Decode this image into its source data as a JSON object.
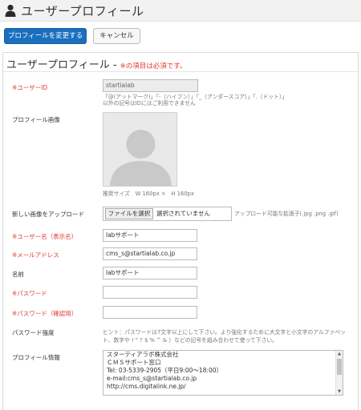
{
  "header": {
    "title": "ユーザープロフィール",
    "icon": "user-icon"
  },
  "actions": {
    "save_label": "プロフィールを変更する",
    "cancel_label": "キャンセル"
  },
  "panel": {
    "title": "ユーザープロフィール -",
    "required_note": "※の項目は必須です。"
  },
  "form": {
    "user_id": {
      "label": "※ユーザーID",
      "value": "startialab",
      "hint_line1": "「@(アットマーク)」「-（ハイフン）」「_（アンダースコア）」「.（ドット）」",
      "hint_line2": "以外の記号はIDにはご利用できません"
    },
    "profile_image": {
      "label": "プロフィール画像",
      "size_hint": "推奨サイズ　W 160px ×　H 160px"
    },
    "upload": {
      "label": "新しい画像をアップロード",
      "button_label": "ファイルを選択",
      "status": "選択されていません",
      "allowed_types": "アップロード可能な拡張子(.jpg .png .gif)"
    },
    "user_name": {
      "label": "※ユーザー名（表示名）",
      "value": "labサポート"
    },
    "email": {
      "label": "※メールアドレス",
      "value": "cms_s@startialab.co.jp"
    },
    "name": {
      "label": "名前",
      "value": "labサポート"
    },
    "password": {
      "label": "※パスワード",
      "value": ""
    },
    "password_confirm": {
      "label": "※パスワード（確認用）",
      "value": ""
    },
    "password_strength": {
      "label": "パスワード強度",
      "hint_line1": "ヒント：パスワードは7文字以上にして下さい。より強化するために大文字と小文字のアルファベッ",
      "hint_line2": "ト、数字や ! \" ? $ % ^ & ）などの記号を組み合わせて使って下さい。"
    },
    "profile_info": {
      "label": "プロフィール情報",
      "lines": [
        "スターティアラボ株式会社",
        "ＣＭＳサポート窓口",
        "Tel: 03-5339-2905（平日9:00～18:00）",
        "e-mail:cms_s@startialab.co.jp",
        "http://cms.digitalink.ne.jp/"
      ]
    }
  },
  "colors": {
    "primary": "#1a6fbf",
    "required": "#e03c31"
  }
}
